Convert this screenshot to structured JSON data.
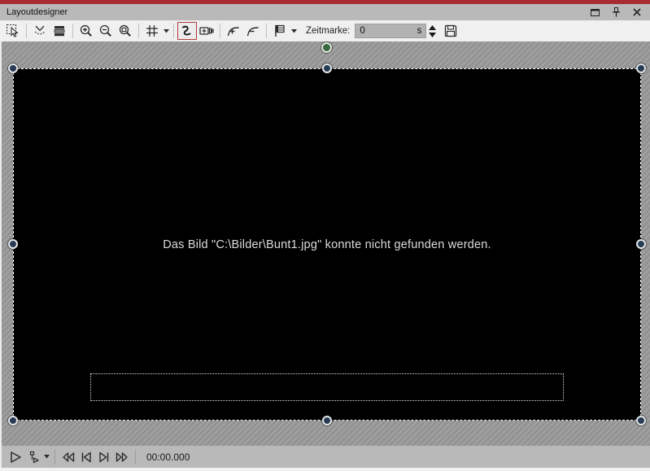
{
  "window": {
    "title": "Layoutdesigner"
  },
  "titlebar": {
    "controls": [
      {
        "name": "maximize-icon"
      },
      {
        "name": "pin-icon"
      },
      {
        "name": "close-icon"
      }
    ]
  },
  "toolbar": {
    "tools": [
      {
        "name": "select-tool-icon",
        "active": false
      },
      {
        "name": "smooth-path-icon",
        "active": false
      },
      {
        "name": "layers-icon",
        "active": false
      },
      {
        "name": "zoom-in-icon",
        "active": false
      },
      {
        "name": "zoom-out-icon",
        "active": false
      },
      {
        "name": "zoom-fit-icon",
        "active": false
      },
      {
        "name": "grid-icon",
        "active": false,
        "has_dropdown": true
      },
      {
        "name": "motion-path-curve-icon",
        "active": true
      },
      {
        "name": "camera-pan-icon",
        "active": false
      },
      {
        "name": "add-curve-point-icon",
        "active": false
      },
      {
        "name": "remove-curve-point-icon",
        "active": false
      },
      {
        "name": "timeline-marker-icon",
        "active": false,
        "has_dropdown": true
      },
      {
        "name": "save-icon",
        "active": false
      }
    ],
    "zeitmarke": {
      "label": "Zeitmarke:",
      "value": "0",
      "unit": "s"
    }
  },
  "stage": {
    "message": "Das Bild \"C:\\Bilder\\Bunt1.jpg\" konnte nicht gefunden werden.",
    "selection_handles": 8,
    "rotation_handle_color": "#39683f",
    "handle_color": "#283b55"
  },
  "transport": {
    "buttons": [
      {
        "name": "play-icon"
      },
      {
        "name": "play-from-marker-icon",
        "has_dropdown": true
      },
      {
        "name": "rewind-icon"
      },
      {
        "name": "skip-to-start-icon"
      },
      {
        "name": "skip-to-end-icon"
      },
      {
        "name": "fast-forward-icon"
      }
    ],
    "time": "00:00.000"
  },
  "colors": {
    "accent_red": "#a92c31",
    "titlebar_gray": "#b9b9b9",
    "toolbar_bg": "#f0f0f0",
    "canvas_gray": "#9b9b9b",
    "stage_black": "#000000",
    "active_tool_border": "#b03a37"
  }
}
